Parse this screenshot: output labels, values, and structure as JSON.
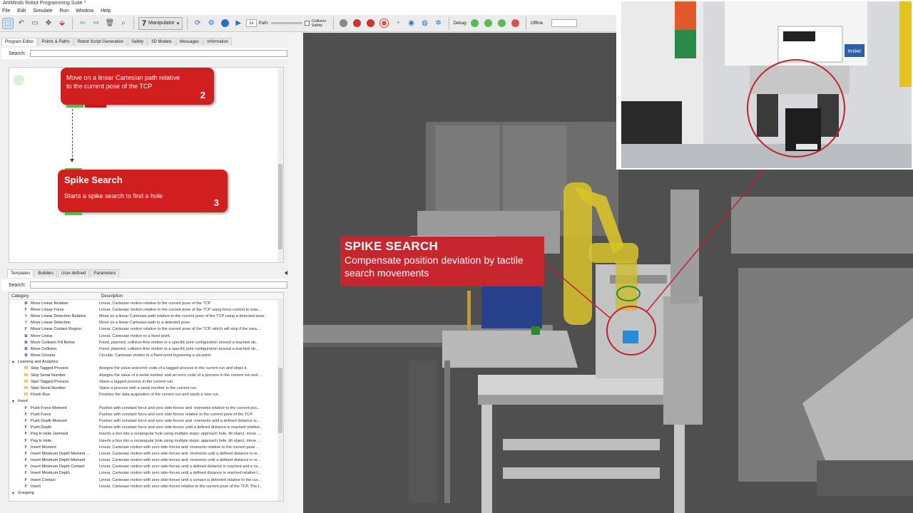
{
  "app": {
    "title": "ArtiMinds Robot Programming Suite *"
  },
  "menu": [
    "File",
    "Edit",
    "Simulate",
    "Run",
    "Window",
    "Help"
  ],
  "toolbar": {
    "manipulator_label": "Manipulator",
    "speed_value": "1x",
    "path_label": "Path:",
    "collision_label": "Collision Safety",
    "debug_label": "Debug:",
    "offline_label": "Offline",
    "connection_value": ""
  },
  "top_tabs": [
    "Program Editor",
    "Points & Paths",
    "Robot Script Generation",
    "Safety",
    "3D Models",
    "Messages",
    "Information"
  ],
  "search_label": "Search:",
  "blocks": [
    {
      "title": "Move on a linear Cartesian path relative to the current pose of the TCP",
      "number": "2"
    },
    {
      "title": "Spike Search",
      "desc": "Starts a spike search to find a hole",
      "number": "3"
    }
  ],
  "bottom_tabs": [
    "Templates",
    "Builders",
    "User-defined",
    "Parameters"
  ],
  "table": {
    "headers": [
      "Category",
      "Description"
    ],
    "rows": [
      {
        "type": "item",
        "icon": "B",
        "color": "#1b3fa8",
        "name": "Move Linear Relative",
        "desc": "Linear, Cartesian motion relative to the current pose of the TCP"
      },
      {
        "type": "item",
        "icon": "F",
        "color": "#c0201a",
        "name": "Move Linear Force",
        "desc": "Linear, Cartesian motion relative to the current pose of the TCP using force-control to esta..."
      },
      {
        "type": "item",
        "icon": "V",
        "color": "#6aa61d",
        "name": "Move Linear Detection Relative",
        "desc": "Move on a linear Cartesian path relative to the current pose of the TCP using a detected pose."
      },
      {
        "type": "item",
        "icon": "V",
        "color": "#6aa61d",
        "name": "Move Linear Detection",
        "desc": "Move on a linear Cartesian path to a detected pose."
      },
      {
        "type": "item",
        "icon": "F",
        "color": "#c0201a",
        "name": "Move Linear Contact Region",
        "desc": "Linear, Cartesian motion relative to the current pose of the TCP, which will stop if the mea..."
      },
      {
        "type": "item",
        "icon": "B",
        "color": "#1b3fa8",
        "name": "Move Linear",
        "desc": "Linear, Cartesian motion to a fixed point."
      },
      {
        "type": "item",
        "icon": "B",
        "color": "#1b3fa8",
        "name": "Move Collision Fill Below",
        "desc": "Fixed, planned, collision-free motion to a specific joint configuration around a teached ob..."
      },
      {
        "type": "item",
        "icon": "B",
        "color": "#1b3fa8",
        "name": "Move Collision",
        "desc": "Fixed, planned, collision-free motion to a specific joint configuration around a teached ob..."
      },
      {
        "type": "item",
        "icon": "B",
        "color": "#1b3fa8",
        "name": "Move Circular",
        "desc": "Circular, Cartesian motion to a fixed point bypassing a via point."
      },
      {
        "type": "cat",
        "name": "Learning and Analytics",
        "desc": ""
      },
      {
        "type": "item",
        "icon": "M",
        "color": "#d49b12",
        "name": "Stop Tagged Process",
        "desc": "Assigns the value and error code of a tagged process in the current run and stops it."
      },
      {
        "type": "item",
        "icon": "M",
        "color": "#d49b12",
        "name": "Stop Serial Number",
        "desc": "Assigns the value of a serial number and an error code of a process in the current run and ..."
      },
      {
        "type": "item",
        "icon": "M",
        "color": "#d49b12",
        "name": "Start Tagged Process",
        "desc": "Starts a tagged process in the current run."
      },
      {
        "type": "item",
        "icon": "M",
        "color": "#d49b12",
        "name": "Start Serial Number",
        "desc": "Starts a process with a serial number in the current run."
      },
      {
        "type": "item",
        "icon": "M",
        "color": "#d49b12",
        "name": "Finish Run",
        "desc": "Finishes the data acquisition of the current run and starts a new run."
      },
      {
        "type": "cat",
        "name": "Insert",
        "desc": ""
      },
      {
        "type": "item",
        "icon": "F",
        "color": "#c0201a",
        "name": "Push Force Moment",
        "desc": "Pushes with constant force and zero side-forces and -moments relative to the current pos..."
      },
      {
        "type": "item",
        "icon": "F",
        "color": "#c0201a",
        "name": "Push Force",
        "desc": "Pushes with constant force and zero side-forces relative to the current pose of the TCP."
      },
      {
        "type": "item",
        "icon": "F",
        "color": "#c0201a",
        "name": "Push Depth Moment",
        "desc": "Pushes with constant force and zero side-forces and -moments until a defined distance is..."
      },
      {
        "type": "item",
        "icon": "F",
        "color": "#c0201a",
        "name": "Push Depth",
        "desc": "Pushes with constant force and zero side-forces until a defined distance is reached relative..."
      },
      {
        "type": "item",
        "icon": "F",
        "color": "#c0201a",
        "name": "Peg In Hole Jammed",
        "desc": "Inserts a box into a rectangular hole using multiple steps: approach hole, tilt object, move ..."
      },
      {
        "type": "item",
        "icon": "F",
        "color": "#c0201a",
        "name": "Peg In Hole",
        "desc": "Inserts a box into a rectangular hole using multiple steps: approach hole, tilt object, move ..."
      },
      {
        "type": "item",
        "icon": "F",
        "color": "#c0201a",
        "name": "Insert Moment",
        "desc": "Linear, Cartesian motion with zero side-forces and -moments relative to the current pose ..."
      },
      {
        "type": "item",
        "icon": "F",
        "color": "#c0201a",
        "name": "Insert Minimum Depth Moment ...",
        "desc": "Linear, Cartesian motion with zero side-forces and -moments until a defined distance is re..."
      },
      {
        "type": "item",
        "icon": "F",
        "color": "#c0201a",
        "name": "Insert Minimum Depth Moment",
        "desc": "Linear, Cartesian motion with zero side-forces and -moments until a defined distance is re..."
      },
      {
        "type": "item",
        "icon": "F",
        "color": "#c0201a",
        "name": "Insert Minimum Depth Contact",
        "desc": "Linear, Cartesian motion with zero side-forces until a defined distance is reached and a co..."
      },
      {
        "type": "item",
        "icon": "F",
        "color": "#c0201a",
        "name": "Insert Minimum Depth",
        "desc": "Linear, Cartesian motion with zero side-forces until a defined distance is reached relative t..."
      },
      {
        "type": "item",
        "icon": "F",
        "color": "#c0201a",
        "name": "Insert Contact",
        "desc": "Linear, Cartesian motion with zero side-forces until a contact is detected relative to the cur..."
      },
      {
        "type": "item",
        "icon": "F",
        "color": "#c0201a",
        "name": "Insert",
        "desc": "Linear, Cartesian motion with zero side-forces relative to the current pose of the TCP. The f..."
      },
      {
        "type": "cat",
        "name": "Grasping",
        "desc": ""
      }
    ]
  },
  "callout": {
    "title": "SPIKE SEARCH",
    "body": "Compensate position deviation by tactile search movements"
  },
  "inset": {
    "label": "RH940"
  }
}
